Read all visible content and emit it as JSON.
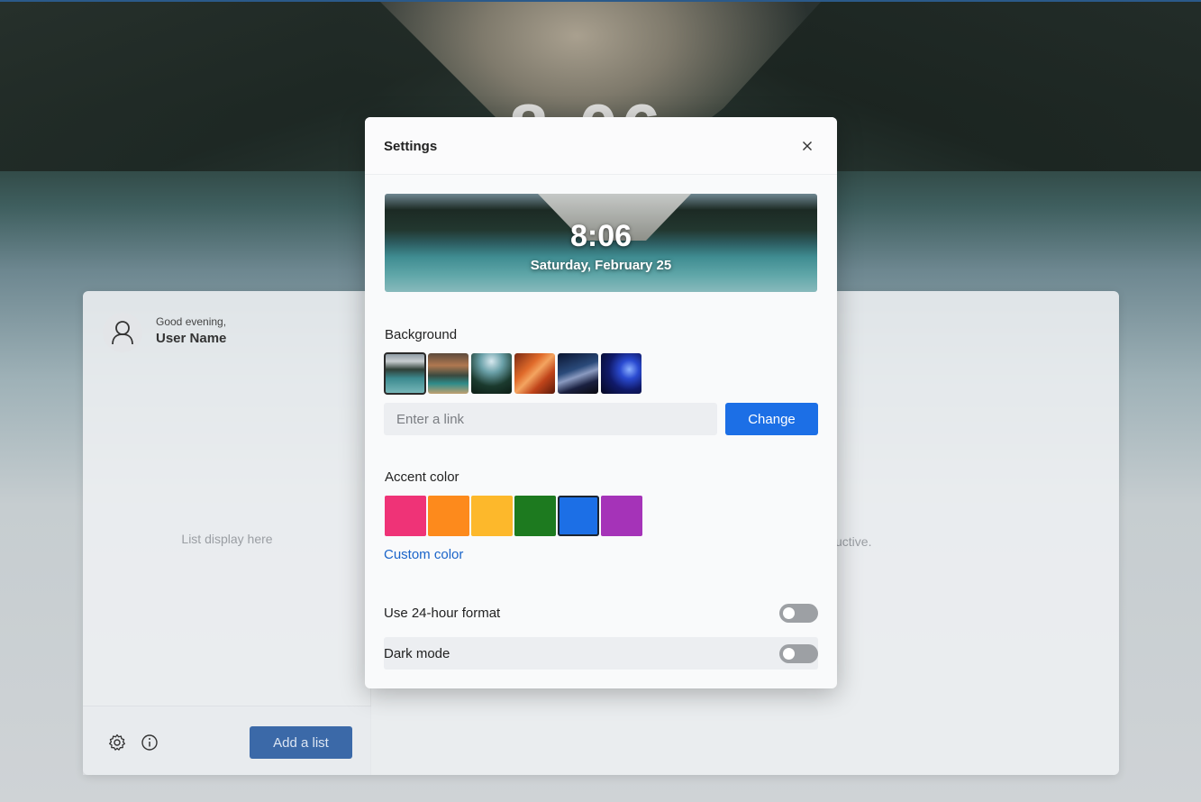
{
  "background": {
    "clock_text": "8:06"
  },
  "app": {
    "greeting": "Good evening,",
    "user_name": "User Name",
    "list_placeholder": "List display here",
    "main_hint": "uctive.",
    "add_list_label": "Add a list",
    "footer_icons": [
      "gear-icon",
      "info-icon"
    ]
  },
  "settings": {
    "title": "Settings",
    "preview": {
      "time": "8:06",
      "date": "Saturday, February 25"
    },
    "background": {
      "label": "Background",
      "thumbnails": [
        "lake-mountains",
        "mountain-sunset",
        "forest-lake",
        "red-canyon",
        "night-sky",
        "space-planet"
      ],
      "selected_index": 0,
      "link_placeholder": "Enter a link",
      "change_label": "Change"
    },
    "accent": {
      "label": "Accent color",
      "colors": [
        "#ef3377",
        "#fd8a1c",
        "#fdb82b",
        "#1d7a1f",
        "#1c6fe6",
        "#a533b8"
      ],
      "selected_index": 4,
      "custom_label": "Custom color"
    },
    "toggles": [
      {
        "label": "Use 24-hour format",
        "on": false
      },
      {
        "label": "Dark mode",
        "on": false
      }
    ]
  }
}
